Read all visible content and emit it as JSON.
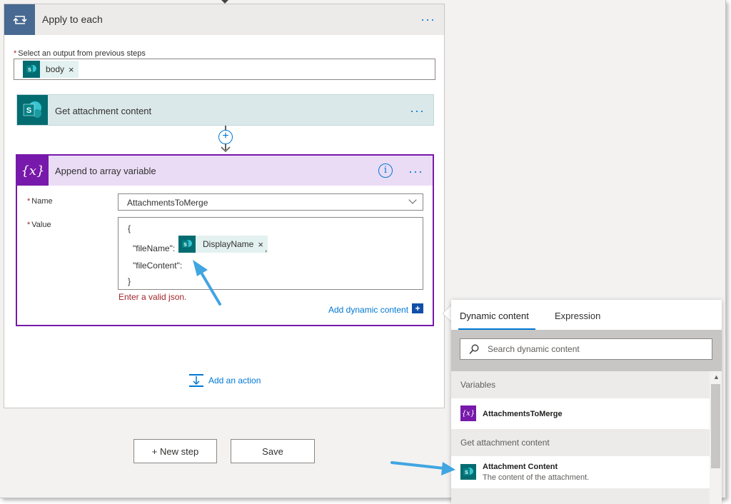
{
  "scope": {
    "title": "Apply to each",
    "more": "···",
    "select_output_label": "Select an output from previous steps",
    "required": "*",
    "token": {
      "label": "body",
      "remove": "×"
    }
  },
  "actions": {
    "get_attachment": {
      "title": "Get attachment content",
      "more": "···"
    },
    "append_array": {
      "title": "Append to array variable",
      "icon_text": "{x}",
      "info": "i",
      "more": "···",
      "name_label": "Name",
      "name_value": "AttachmentsToMerge",
      "value_label": "Value",
      "value_lines": {
        "open": "{",
        "file_name_key": "\"fileName\":",
        "file_name_token": "DisplayName",
        "file_name_token_remove": "×",
        "comma": ",",
        "file_content_key": "\"fileContent\":",
        "close": "}"
      },
      "error": "Enter a valid json.",
      "add_dynamic": "Add dynamic content",
      "add_dynamic_icon": "+"
    },
    "connector_plus": "+",
    "add_action": "Add an action"
  },
  "footer": {
    "new_step": "+ New step",
    "save": "Save"
  },
  "dynamic_panel": {
    "tabs": [
      "Dynamic content",
      "Expression"
    ],
    "active_tab": "Dynamic content",
    "search_placeholder": "Search dynamic content",
    "sections": [
      {
        "header": "Variables",
        "items": [
          {
            "title": "AttachmentsToMerge",
            "icon": "variable-icon",
            "icon_text": "{x}"
          }
        ]
      },
      {
        "header": "Get attachment content",
        "items": [
          {
            "title": "Attachment Content",
            "description": "The content of the attachment.",
            "icon": "sharepoint-icon"
          }
        ]
      }
    ]
  },
  "colors": {
    "accent": "#0078d4",
    "variable_purple": "#7719aa",
    "sharepoint_teal": "#036c70",
    "scope_blue": "#486991",
    "error_red": "#a4262c",
    "annotation_arrow": "#41a5e1"
  }
}
